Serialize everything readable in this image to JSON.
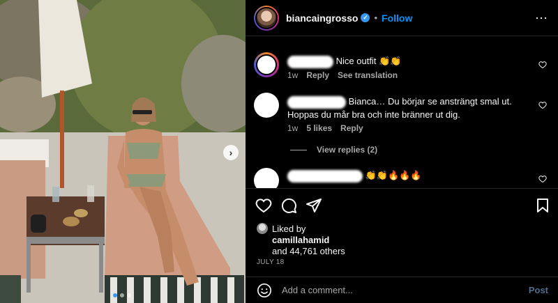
{
  "header": {
    "username": "biancaingrosso",
    "separator": "•",
    "follow_label": "Follow",
    "more_icon": "⋯"
  },
  "photo": {
    "next_icon": "›",
    "slide_count": 3,
    "active_slide": 1
  },
  "comments": [
    {
      "text": "Nice outfit 👏👏",
      "time": "1w",
      "reply_label": "Reply",
      "translate_label": "See translation"
    },
    {
      "text": "Bianca… Du börjar se ansträngt smal ut. Hoppas du mår bra och inte bränner ut dig.",
      "time": "1w",
      "likes_label": "5 likes",
      "reply_label": "Reply"
    },
    {
      "text": "👏👏🔥🔥🔥"
    }
  ],
  "view_replies_label": "View replies (2)",
  "likes": {
    "liked_by_label": "Liked by",
    "liker": "camillahamid",
    "others_text": "and 44,761 others"
  },
  "date": "JULY 18",
  "add_comment": {
    "placeholder": "Add a comment...",
    "post_label": "Post"
  },
  "colors": {
    "follow": "#0095f6",
    "post_disabled": "#4f6e8f",
    "secondary_text": "#a8a8a8"
  }
}
